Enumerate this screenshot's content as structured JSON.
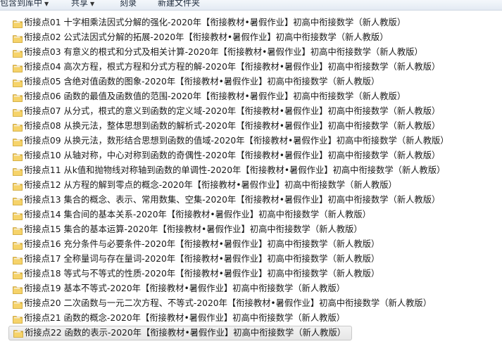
{
  "toolbar": {
    "items": [
      {
        "label": "包含到库中",
        "has_arrow": true
      },
      {
        "label": "共享",
        "has_arrow": true
      },
      {
        "label": "刻录",
        "has_arrow": false
      },
      {
        "label": "新建文件夹",
        "has_arrow": false
      }
    ]
  },
  "folders": [
    "衔接点01 十字相乘法因式分解的强化-2020年【衔接教材•暑假作业】初高中衔接数学（新人教版）",
    "衔接点02 公式法因式分解的拓展-2020年【衔接教材•暑假作业】初高中衔接数学（新人教版）",
    "衔接点03 有意义的根式和分式及相关计算-2020年【衔接教材•暑假作业】初高中衔接数学（新人教版）",
    "衔接点04 高次方程，根式方程和分式方程的解-2020年【衔接教材•暑假作业】初高中衔接数学（新人教版）",
    "衔接点05 含绝对值函数的图象-2020年【衔接教材•暑假作业】初高中衔接数学（新人教版）",
    "衔接点06 函数的最值及函数值的范围-2020年【衔接教材•暑假作业】初高中衔接数学（新人教版）",
    "衔接点07 从分式，根式的意义到函数的定义域-2020年【衔接教材•暑假作业】初高中衔接数学（新人教版）",
    "衔接点08 从换元法，整体思想到函数的解析式-2020年【衔接教材•暑假作业】初高中衔接数学（新人教版）",
    "衔接点09 从换元法，数形结合思想到函数的值域-2020年【衔接教材•暑假作业】初高中衔接数学（新人教版）",
    "衔接点10 从轴对称，中心对称到函数的奇偶性-2020年【衔接教材•暑假作业】初高中衔接数学（新人教版）",
    "衔接点11 从k值和抛物线对称轴到函数的单调性-2020年【衔接教材•暑假作业】初高中衔接数学（新人教版）",
    "衔接点12 从方程的解到零点的概念-2020年【衔接教材•暑假作业】初高中衔接数学（新人教版）",
    "衔接点13 集合的概念、表示、常用数集、空集-2020年【衔接教材•暑假作业】初高中衔接数学（新人教版）",
    "衔接点14 集合间的基本关系-2020年【衔接教材•暑假作业】初高中衔接数学（新人教版）",
    "衔接点15 集合的基本运算-2020年【衔接教材•暑假作业】初高中衔接数学（新人教版）",
    "衔接点16 充分条件与必要条件-2020年【衔接教材•暑假作业】初高中衔接数学（新人教版）",
    "衔接点17 全称量词与存在量词-2020年【衔接教材•暑假作业】初高中衔接数学（新人教版）",
    "衔接点18 等式与不等式的性质-2020年【衔接教材•暑假作业】初高中衔接数学（新人教版）",
    "衔接点19 基本不等式-2020年【衔接教材•暑假作业】初高中衔接数学（新人教版）",
    "衔接点20 二次函数与一元二次方程、不等式-2020年【衔接教材•暑假作业】初高中衔接数学（新人教版）",
    "衔接点21 函数的概念-2020年【衔接教材•暑假作业】初高中衔接数学（新人教版）",
    "衔接点22 函数的表示-2020年【衔接教材•暑假作业】初高中衔接数学（新人教版）"
  ],
  "selected_index": 21,
  "colors": {
    "folder_body": "#e8b935",
    "folder_front": "#f6d36a",
    "selection_border": "#c9c9c9"
  }
}
